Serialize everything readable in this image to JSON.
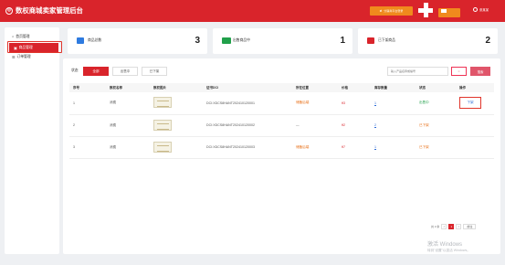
{
  "header": {
    "title": "数权商城卖家管理后台",
    "action_button": "分销商平台登录",
    "user_label": "张某某",
    "colors": {
      "brand": "#d9242b",
      "accent": "#f08a1d"
    }
  },
  "sidebar": {
    "items": [
      {
        "label": "首页管理",
        "icon": "home-icon"
      },
      {
        "label": "商品管理",
        "icon": "box-icon"
      },
      {
        "label": "订单管理",
        "icon": "list-icon"
      }
    ]
  },
  "stats": [
    {
      "label": "商品总数",
      "value": "3",
      "icon_color": "#2e7be0"
    },
    {
      "label": "出售商品中",
      "value": "1",
      "icon_color": "#21a04a"
    },
    {
      "label": "已下架商品",
      "value": "2",
      "icon_color": "#d9242b"
    }
  ],
  "filter": {
    "label": "状态",
    "tabs": [
      "全部",
      "出售中",
      "已下架"
    ],
    "search_placeholder": "输入产品名称或编号",
    "reset_label": "",
    "search_label": "搜索"
  },
  "table": {
    "columns": [
      "序号",
      "数权名称",
      "数权图片",
      "证书DCI",
      "所在位置",
      "价格",
      "库存数量",
      "状态",
      "操作"
    ],
    "rows": [
      {
        "index": "1",
        "name": "消费",
        "dci": "DCI:XDCS8HANT202410120001",
        "location": "储备后端",
        "price": "¥3",
        "qty": "1",
        "status": "出售中",
        "action": "下架"
      },
      {
        "index": "2",
        "name": "消费",
        "dci": "DCI:XDCS8HANT202410120002",
        "location": "—",
        "price": "¥2",
        "qty": "2",
        "status": "已下架",
        "action": ""
      },
      {
        "index": "3",
        "name": "消费",
        "dci": "DCI:XDCS8HANT202410120003",
        "location": "储备后端",
        "price": "¥7",
        "qty": "1",
        "status": "已下架",
        "action": ""
      }
    ]
  },
  "pagination": {
    "total": "共 3 条",
    "prev": "<",
    "current": "1",
    "next": ">",
    "goto": "前往"
  },
  "watermark": {
    "line1": "激活 Windows",
    "line2": "转到\"设置\"以激活 Windows。"
  }
}
